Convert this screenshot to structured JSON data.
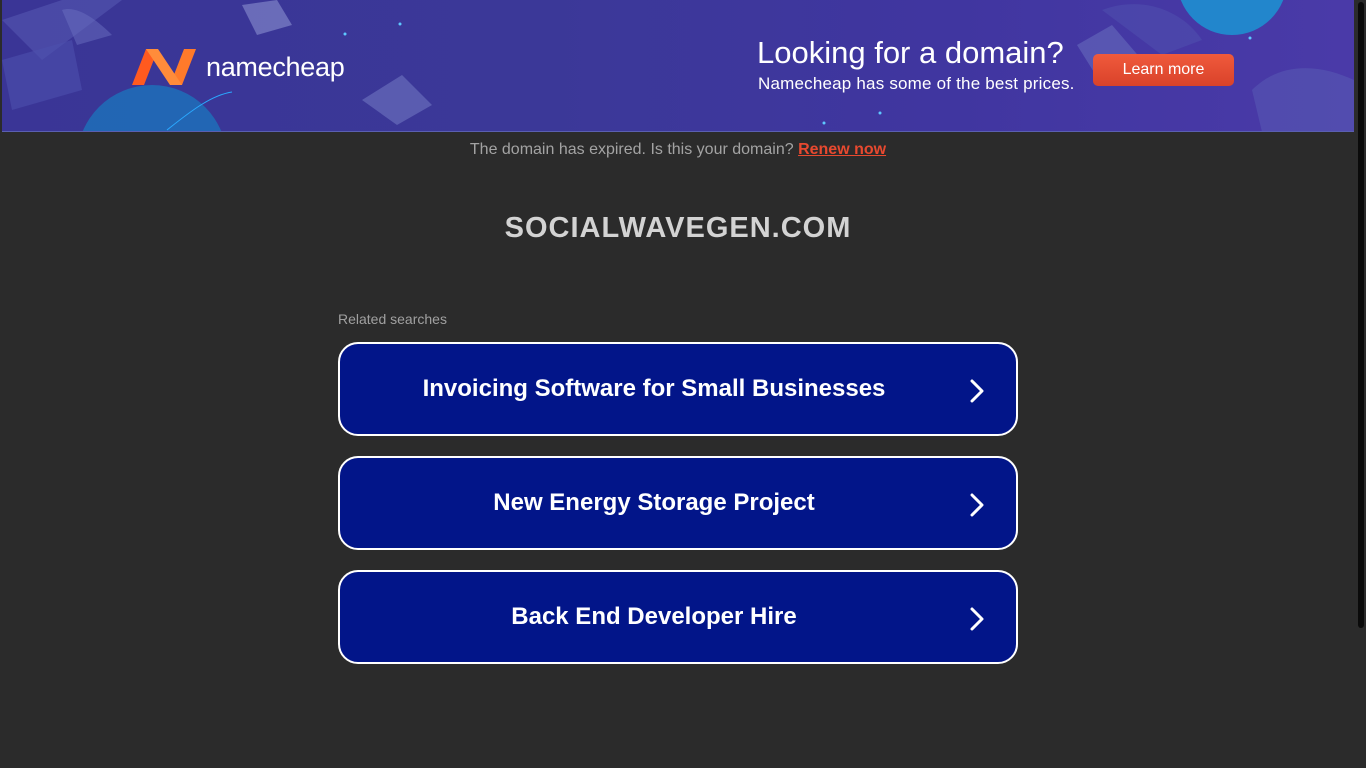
{
  "banner": {
    "brand": "namecheap",
    "promo_title": "Looking for a domain?",
    "promo_subtitle": "Namecheap has some of the best prices.",
    "cta_label": "Learn more",
    "colors": {
      "background": "#3b3898",
      "cta": "#e8492f",
      "logo_orange": "#ff5f1f"
    }
  },
  "notice": {
    "text": "The domain has expired. Is this your domain?",
    "link_label": "Renew now"
  },
  "domain": "SOCIALWAVEGEN.COM",
  "related": {
    "label": "Related searches",
    "items": [
      {
        "label": "Invoicing Software for Small Businesses",
        "icon": "chevron-right-icon"
      },
      {
        "label": "New Energy Storage Project",
        "icon": "chevron-right-icon"
      },
      {
        "label": "Back End Developer Hire",
        "icon": "chevron-right-icon"
      }
    ]
  }
}
